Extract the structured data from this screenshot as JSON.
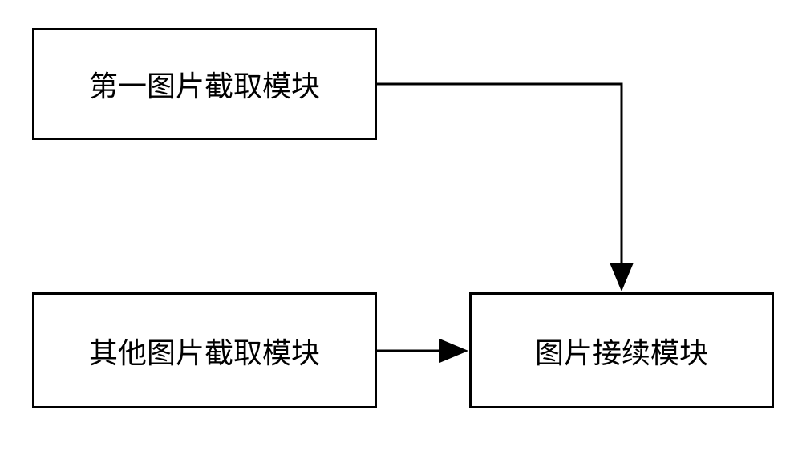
{
  "boxes": {
    "box1": "第一图片截取模块",
    "box2": "其他图片截取模块",
    "box3": "图片接续模块"
  }
}
